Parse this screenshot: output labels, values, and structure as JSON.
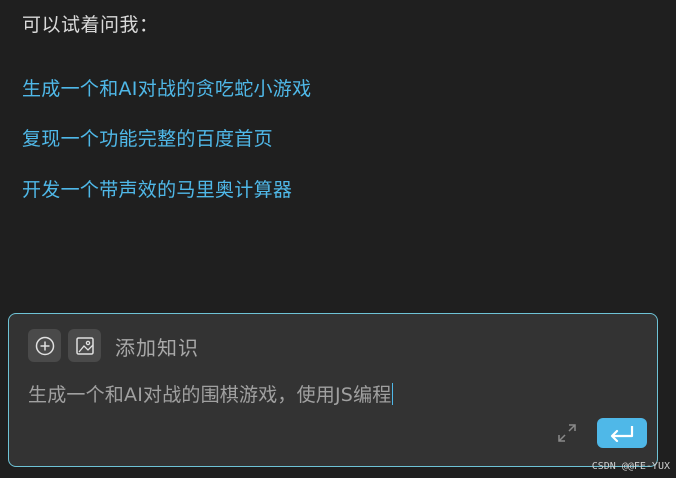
{
  "prompt_title": "可以试着问我：",
  "suggestions": [
    "生成一个和AI对战的贪吃蛇小游戏",
    "复现一个功能完整的百度首页",
    "开发一个带声效的马里奥计算器"
  ],
  "composer": {
    "add_knowledge_label": "添加知识",
    "input_value": "生成一个和AI对战的围棋游戏，使用JS编程"
  },
  "watermark": "CSDN @@FE-YUX",
  "colors": {
    "background": "#1f1f1f",
    "accent": "#4fb8e8",
    "composer_bg": "#333333",
    "composer_border": "#6ec3d6"
  },
  "icons": {
    "add": "plus-circle-icon",
    "image": "image-icon",
    "expand": "expand-icon",
    "send": "enter-return-icon"
  }
}
